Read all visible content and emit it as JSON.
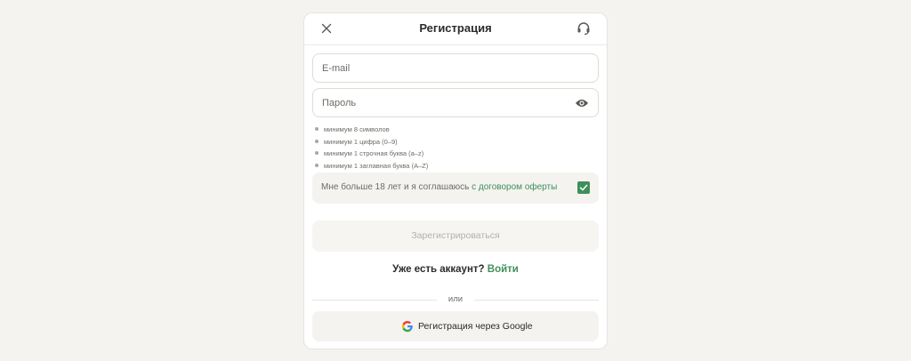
{
  "header": {
    "title": "Регистрация",
    "close_icon": "close-icon",
    "support_icon": "headset-icon"
  },
  "form": {
    "email": {
      "value": "",
      "placeholder": "E-mail"
    },
    "password": {
      "value": "",
      "placeholder": "Пароль",
      "toggle_icon": "eye-icon"
    },
    "rules": [
      "минимум 8 символов",
      "минимум 1 цифра (0–9)",
      "минимум 1 строчная буква (a–z)",
      "минимум 1 заглавная буква (A–Z)"
    ],
    "agreement": {
      "text": "Мне больше 18 лет и я соглашаюсь",
      "link": "с договором оферты",
      "checked": true
    },
    "submit_label": "Зарегистрироваться"
  },
  "login": {
    "prompt": "Уже есть аккаунт?",
    "link": "Войти"
  },
  "divider_label": "или",
  "google_button": {
    "label": "Регистрация через Google",
    "icon": "google-icon"
  },
  "colors": {
    "accent": "#3f8f5b",
    "background": "#f4f3ef"
  }
}
